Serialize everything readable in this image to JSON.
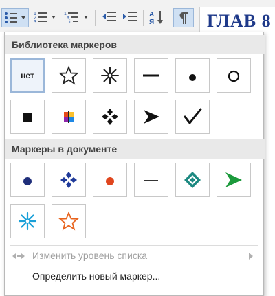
{
  "document": {
    "title_fragment": "ГЛАВ 8"
  },
  "dropdown": {
    "library": {
      "heading": "Библиотека маркеров",
      "none_label": "нет"
    },
    "document_markers": {
      "heading": "Маркеры в документе"
    },
    "menu": {
      "change_level": "Изменить уровень списка",
      "define_new": "Определить новый маркер..."
    }
  }
}
